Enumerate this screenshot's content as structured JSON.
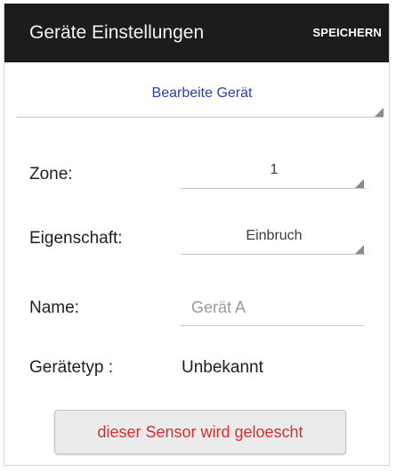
{
  "appbar": {
    "title": "Geräte Einstellungen",
    "action_label": "SPEICHERN"
  },
  "device_spinner": {
    "value": "Bearbeite Gerät"
  },
  "form": {
    "zone": {
      "label": "Zone:",
      "value": "1"
    },
    "property": {
      "label": "Eigenschaft:",
      "value": "Einbruch"
    },
    "name": {
      "label": "Name:",
      "placeholder": "Gerät A",
      "value": ""
    },
    "device_type": {
      "label": "Gerätetyp :",
      "value": "Unbekannt"
    }
  },
  "delete_button": {
    "label": "dieser Sensor wird geloescht"
  },
  "colors": {
    "appbar_background": "#1c1c1c",
    "spinner_link": "#2a3fa8",
    "delete_text": "#d62f2f"
  }
}
